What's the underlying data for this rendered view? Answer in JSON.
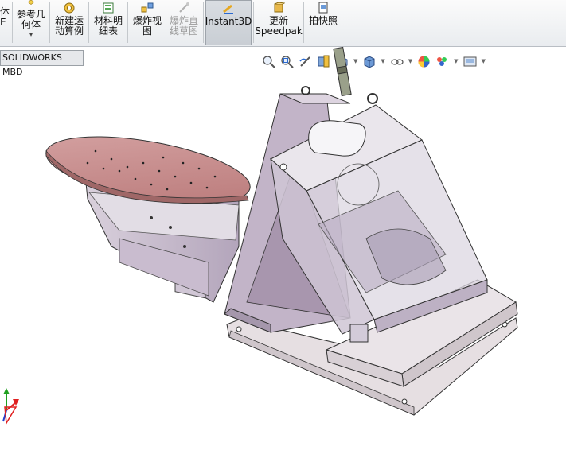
{
  "ribbon": {
    "partial_left_top": "体",
    "partial_left_bottom": "E",
    "ref_geometry_line1": "参考几",
    "ref_geometry_line2": "何体",
    "ref_geometry_arrow": "▾",
    "motion_study_line1": "新建运",
    "motion_study_line2": "动算例",
    "bom_line1": "材料明",
    "bom_line2": "细表",
    "exploded_view_line1": "爆炸视",
    "exploded_view_line2": "图",
    "explode_line_line1": "爆炸直",
    "explode_line_line2": "线草图",
    "instant3d": "Instant3D",
    "speedpak_line1": "更新",
    "speedpak_line2": "Speedpak",
    "snapshot": "拍快照"
  },
  "tab": {
    "label": "SOLIDWORKS MBD"
  },
  "hud_icons": [
    "zoom-to-fit-icon",
    "zoom-area-icon",
    "previous-view-icon",
    "section-view-icon",
    "view-orientation-icon",
    "display-style-icon",
    "hide-show-items-icon",
    "edit-appearance-icon",
    "apply-scene-icon",
    "view-settings-icon"
  ],
  "colors": {
    "ribbon_bg": "#eceef0",
    "active_tool": "#c9ced4",
    "turntable_top": "#c98f8f",
    "body_purple": "#c9bcd0",
    "base_plate": "#e4dcdf",
    "triad_red": "#e02020",
    "triad_green": "#20a020"
  }
}
